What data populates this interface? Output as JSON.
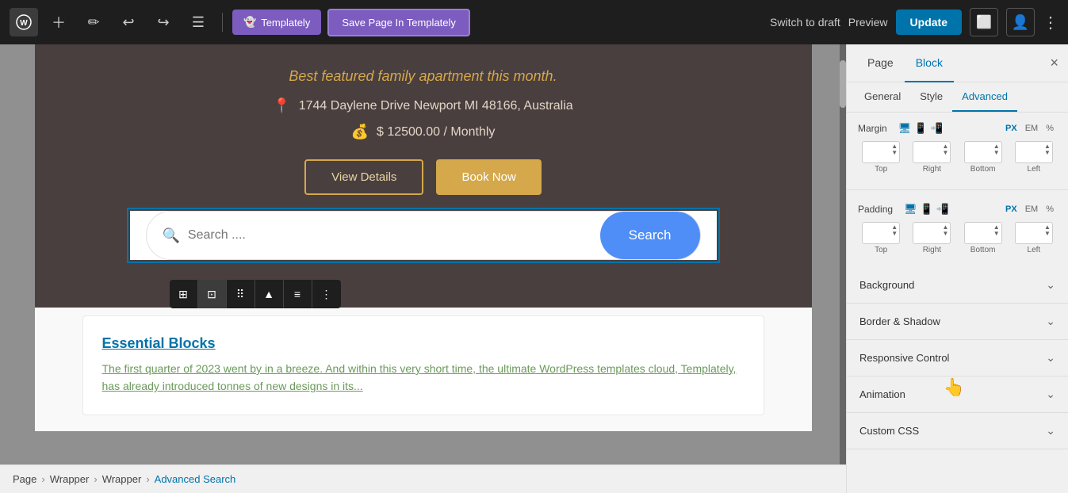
{
  "toolbar": {
    "templately_label": "Templately",
    "save_label": "Save Page In Templately",
    "switch_draft_label": "Switch to draft",
    "preview_label": "Preview",
    "update_label": "Update"
  },
  "canvas": {
    "subtitle": "Best featured family apartment this month.",
    "location": "1744 Daylene Drive Newport MI 48166, Australia",
    "price": "$ 12500.00 / Monthly",
    "btn_view": "View Details",
    "btn_book": "Book Now",
    "search_placeholder": "Search ....",
    "search_button": "Search",
    "blog_title": "Essential Blocks",
    "blog_excerpt": "The first quarter of 2023 went by in a breeze. And within this very short time, the ultimate WordPress templates cloud, Templately, has already introduced tonnes of new designs in its..."
  },
  "breadcrumb": {
    "items": [
      "Page",
      "Wrapper",
      "Wrapper",
      "Advanced Search"
    ]
  },
  "panel": {
    "tabs": [
      "Page",
      "Block"
    ],
    "active_tab": "Block",
    "close_label": "×",
    "sub_tabs": [
      "General",
      "Style",
      "Advanced"
    ],
    "active_sub_tab": "Advanced",
    "margin_label": "Margin",
    "padding_label": "Padding",
    "units": [
      "PX",
      "EM",
      "%"
    ],
    "active_unit": "PX",
    "margin_fields": {
      "top": "",
      "right": "",
      "bottom": "",
      "left": ""
    },
    "padding_fields": {
      "top": "",
      "right": "",
      "bottom": "",
      "left": ""
    },
    "field_labels": {
      "top": "Top",
      "right": "Right",
      "bottom": "Bottom",
      "left": "Left"
    },
    "sections": [
      {
        "id": "background",
        "label": "Background",
        "expanded": false
      },
      {
        "id": "border-shadow",
        "label": "Border & Shadow",
        "expanded": false
      },
      {
        "id": "responsive-control",
        "label": "Responsive Control",
        "expanded": false
      },
      {
        "id": "animation",
        "label": "Animation",
        "expanded": false
      },
      {
        "id": "custom-css",
        "label": "Custom CSS",
        "expanded": false
      }
    ]
  }
}
